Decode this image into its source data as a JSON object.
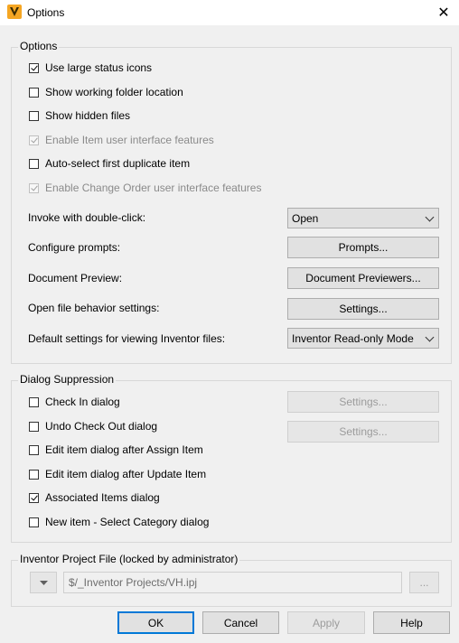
{
  "window": {
    "title": "Options",
    "app_icon": "autodesk-vault-icon",
    "close_glyph": "✕"
  },
  "options": {
    "group_label": "Options",
    "checkboxes": [
      {
        "label": "Use large status icons",
        "checked": true,
        "enabled": true
      },
      {
        "label": "Show working folder location",
        "checked": false,
        "enabled": true
      },
      {
        "label": "Show hidden files",
        "checked": false,
        "enabled": true
      },
      {
        "label": "Enable Item user interface features",
        "checked": true,
        "enabled": false
      },
      {
        "label": "Auto-select first duplicate item",
        "checked": false,
        "enabled": true
      },
      {
        "label": "Enable Change Order user interface features",
        "checked": true,
        "enabled": false
      }
    ],
    "invoke_label": "Invoke with double-click:",
    "invoke_value": "Open",
    "configure_prompts_label": "Configure prompts:",
    "prompts_button": "Prompts...",
    "document_preview_label": "Document Preview:",
    "document_previewers_button": "Document Previewers...",
    "open_file_label": "Open file behavior settings:",
    "open_file_settings_button": "Settings...",
    "default_viewing_label": "Default settings for viewing Inventor files:",
    "default_viewing_value": "Inventor Read-only Mode"
  },
  "dialog_suppression": {
    "group_label": "Dialog Suppression",
    "checkboxes": [
      {
        "label": "Check In dialog",
        "checked": false
      },
      {
        "label": "Undo Check Out dialog",
        "checked": false
      },
      {
        "label": "Edit item dialog after Assign Item",
        "checked": false
      },
      {
        "label": "Edit item dialog after Update Item",
        "checked": false
      },
      {
        "label": "Associated Items dialog",
        "checked": true
      },
      {
        "label": "New item - Select Category dialog",
        "checked": false
      }
    ],
    "check_in_settings_button": "Settings...",
    "undo_checkout_settings_button": "Settings..."
  },
  "project_file": {
    "group_label": "Inventor Project File (locked by administrator)",
    "path_value": "$/_Inventor Projects/VH.ipj",
    "browse_button": "..."
  },
  "footer": {
    "ok": "OK",
    "cancel": "Cancel",
    "apply": "Apply",
    "help": "Help"
  }
}
